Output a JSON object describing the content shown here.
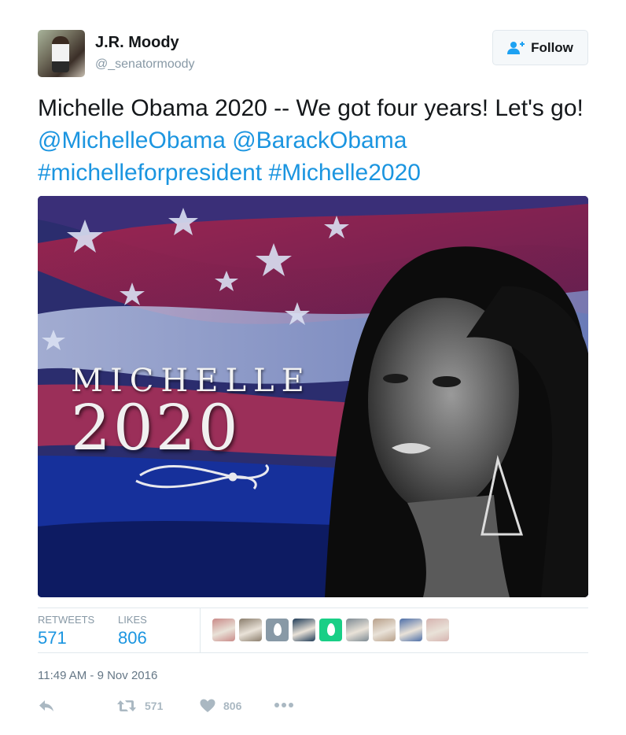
{
  "author": {
    "name": "J.R. Moody",
    "handle": "@_senatormoody"
  },
  "follow_button": {
    "label": "Follow",
    "icon": "add-user-icon"
  },
  "tweet": {
    "text_plain": "Michelle Obama 2020 -- We got four years! Let's go! ",
    "mention_1": "@MichelleObama",
    "mention_2": "@BarackObama",
    "hashtag_1": "#michelleforpresident",
    "hashtag_2": "#Michelle2020"
  },
  "media": {
    "title_word": "MICHELLE",
    "title_year": "2020"
  },
  "stats": {
    "retweets_label": "RETWEETS",
    "retweets_count": "571",
    "likes_label": "LIKES",
    "likes_count": "806"
  },
  "likers": [
    {
      "kind": "photo",
      "color": "#c98a88"
    },
    {
      "kind": "photo",
      "color": "#8a7d6c"
    },
    {
      "kind": "egg",
      "color": "#8899a6"
    },
    {
      "kind": "photo",
      "color": "#1f3b57"
    },
    {
      "kind": "egg",
      "color": "#19cf86"
    },
    {
      "kind": "photo",
      "color": "#7d8a93"
    },
    {
      "kind": "photo",
      "color": "#b8a08a"
    },
    {
      "kind": "photo",
      "color": "#4c6ea8"
    },
    {
      "kind": "photo",
      "color": "#d6b4b0"
    }
  ],
  "timestamp": "11:49 AM - 9 Nov 2016",
  "actions": {
    "reply_icon": "reply-icon",
    "retweet_icon": "retweet-icon",
    "retweet_count": "571",
    "like_icon": "heart-icon",
    "like_count": "806",
    "more_icon": "more-dots-icon"
  },
  "colors": {
    "link": "#1b95e0",
    "muted": "#8899a6",
    "text": "#14171a"
  }
}
